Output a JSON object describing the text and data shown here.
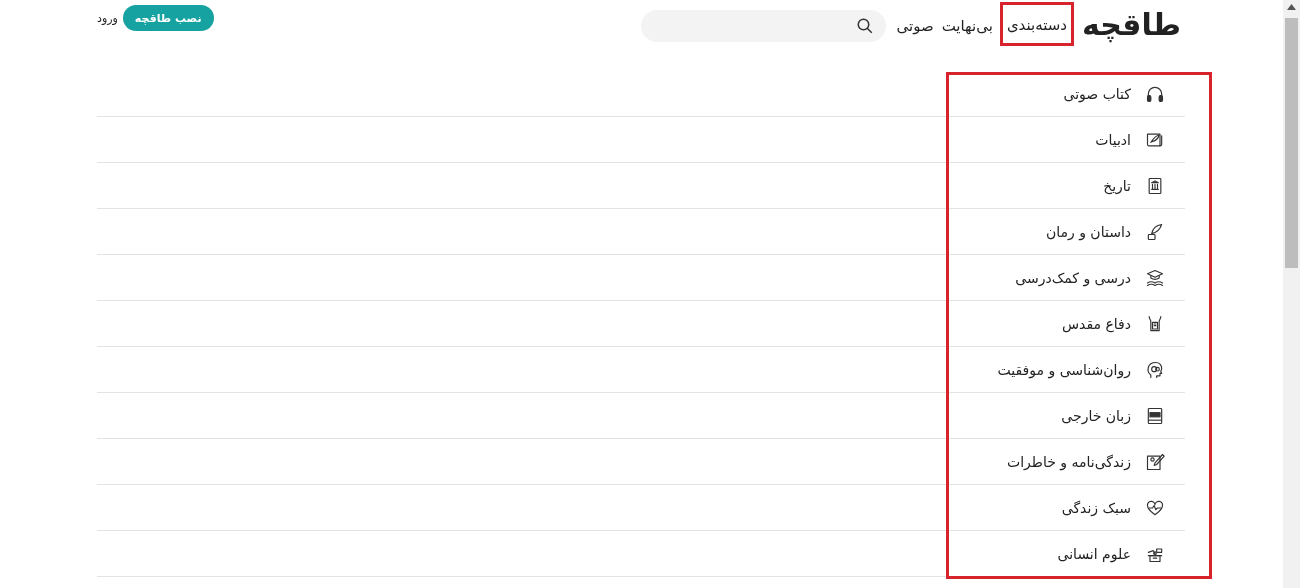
{
  "header": {
    "logo": "طاقچه",
    "nav": [
      {
        "label": "دسته‌بندی",
        "highlighted": true
      },
      {
        "label": "بی‌نهایت",
        "highlighted": false
      },
      {
        "label": "صوتی",
        "highlighted": false
      }
    ],
    "install_button": "نصب طاقچه",
    "login": "ورود"
  },
  "categories": {
    "highlighted": true,
    "items": [
      {
        "label": "کتاب صوتی"
      },
      {
        "label": "ادبیات"
      },
      {
        "label": "تاریخ"
      },
      {
        "label": "داستان و رمان"
      },
      {
        "label": "درسی و کمک‌درسی"
      },
      {
        "label": "دفاع مقدس"
      },
      {
        "label": "روان‌شناسی و موفقیت"
      },
      {
        "label": "زبان خارجی"
      },
      {
        "label": "زندگی‌نامه و خاطرات"
      },
      {
        "label": "سبک زندگی"
      },
      {
        "label": "علوم انسانی"
      }
    ]
  }
}
